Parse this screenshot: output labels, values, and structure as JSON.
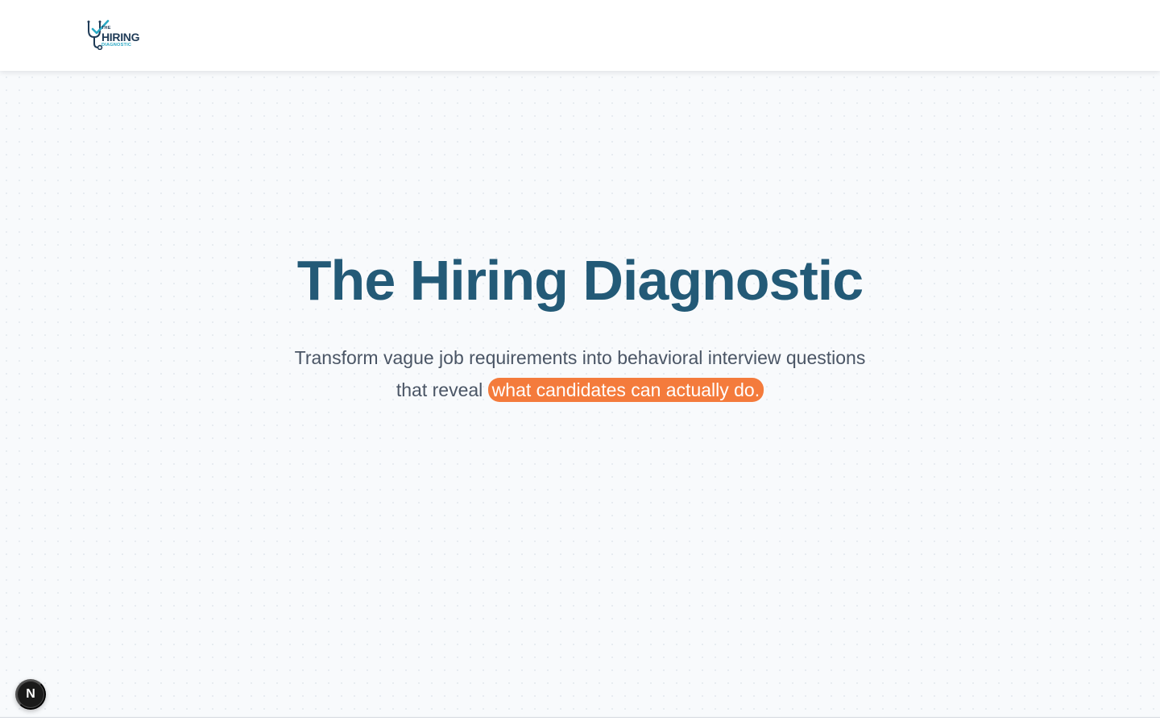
{
  "header": {
    "logo": {
      "line1": "THE",
      "line2": "HIRING",
      "line3": "DIAGNOSTIC",
      "icon": "stethoscope-check-icon"
    }
  },
  "hero": {
    "title": "The Hiring Diagnostic",
    "subtitle_line1": "Transform vague job requirements into behavioral interview questions",
    "subtitle_prefix": "that reveal ",
    "subtitle_highlight": "what candidates can actually do."
  },
  "dev_badge": {
    "label": "N",
    "icon": "nextjs-icon"
  },
  "colors": {
    "title": "#235a77",
    "highlight": "#f47b3c",
    "subtitle": "#4a5565",
    "background": "#f8fafc",
    "logo_dark": "#1f3b57",
    "logo_accent": "#2aa8c4"
  }
}
